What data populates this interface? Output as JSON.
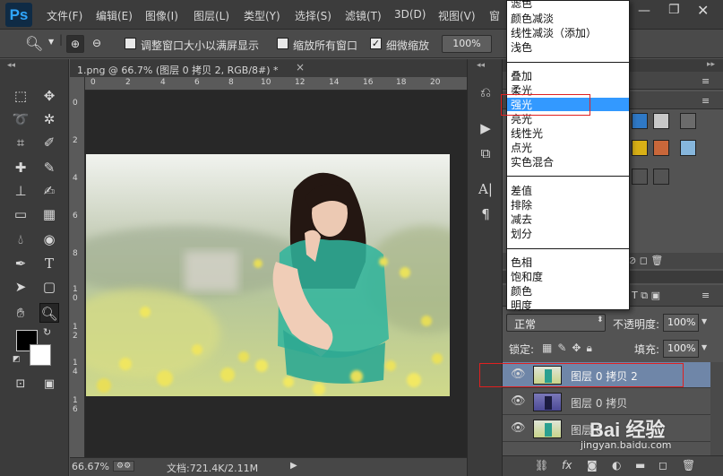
{
  "app": {
    "logo": "Ps"
  },
  "menu": [
    "文件(F)",
    "编辑(E)",
    "图像(I)",
    "图层(L)",
    "类型(Y)",
    "选择(S)",
    "滤镜(T)",
    "3D(D)",
    "视图(V)",
    "窗"
  ],
  "options": {
    "resize_windows": "调整窗口大小以满屏显示",
    "zoom_all": "缩放所有窗口",
    "scrubby_zoom": "细微缩放",
    "zoom_value": "100%"
  },
  "document": {
    "tab_title": "1.png @ 66.7% (图层 0 拷贝 2, RGB/8#) *",
    "close": "×",
    "ruler_top": [
      "0",
      "2",
      "4",
      "6",
      "8",
      "10",
      "12",
      "14",
      "16",
      "18",
      "20"
    ],
    "ruler_left": [
      "0",
      "2",
      "4",
      "6",
      "8",
      "1 0",
      "1 2",
      "1 4",
      "1 6"
    ]
  },
  "status": {
    "zoom": "66.67%",
    "doc_info": "文档:721.4K/2.11M"
  },
  "blend_modes": {
    "group_darken": [
      "滤色",
      "颜色减淡",
      "线性减淡（添加）",
      "浅色"
    ],
    "group_overlay": [
      "叠加",
      "柔光",
      "强光",
      "亮光",
      "线性光",
      "点光",
      "实色混合"
    ],
    "group_difference": [
      "差值",
      "排除",
      "减去",
      "划分"
    ],
    "group_component": [
      "色相",
      "饱和度",
      "颜色",
      "明度"
    ],
    "selected": "强光"
  },
  "layers_panel": {
    "blend_mode": "正常",
    "opacity_label": "不透明度:",
    "opacity_value": "100%",
    "lock_label": "锁定:",
    "fill_label": "填充:",
    "fill_value": "100%",
    "layers": [
      {
        "name": "图层 0 拷贝 2",
        "selected": true
      },
      {
        "name": "图层 0 拷贝",
        "selected": false
      },
      {
        "name": "图层 0",
        "selected": false
      }
    ]
  },
  "watermark": {
    "brand": "Bai 经验",
    "url": "jingyan.baidu.com"
  },
  "colors": {
    "selection_blue": "#3399ff",
    "annotation_red": "#e02020",
    "selected_layer": "#6f86a8"
  }
}
